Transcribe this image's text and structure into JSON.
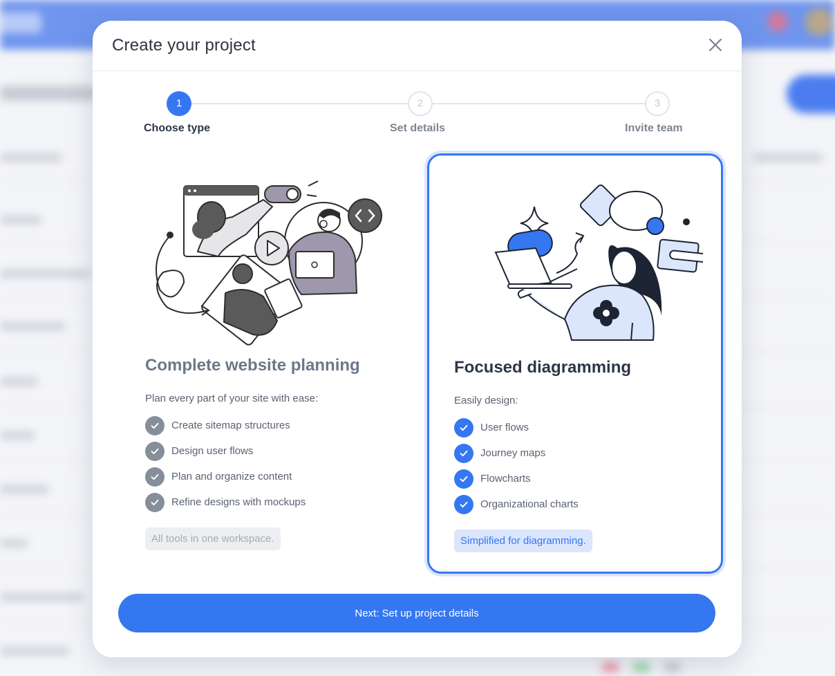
{
  "modal": {
    "title": "Create your project",
    "close_label": "close"
  },
  "stepper": {
    "steps": [
      {
        "number": "1",
        "label": "Choose type",
        "active": true
      },
      {
        "number": "2",
        "label": "Set details",
        "active": false
      },
      {
        "number": "3",
        "label": "Invite team",
        "active": false
      }
    ]
  },
  "cards": [
    {
      "title": "Complete website planning",
      "subtitle": "Plan every part of your site with ease:",
      "features": [
        "Create sitemap structures",
        "Design user flows",
        "Plan and organize content",
        "Refine designs with mockups"
      ],
      "tag": "All tools in one workspace.",
      "selected": false,
      "illustration": "website-planning-illustration"
    },
    {
      "title": "Focused diagramming",
      "subtitle": "Easily design:",
      "features": [
        "User flows",
        "Journey maps",
        "Flowcharts",
        "Organizational charts"
      ],
      "tag": "Simplified for diagramming.",
      "selected": true,
      "illustration": "diagramming-illustration"
    }
  ],
  "next_button": {
    "label": "Next: Set up project details"
  },
  "colors": {
    "accent": "#3577f0",
    "accent_light": "#dbe6fc",
    "text_dark": "#2d3748",
    "muted_check": "#868e99"
  },
  "icons": {
    "close": "close-icon",
    "check": "check-icon"
  }
}
